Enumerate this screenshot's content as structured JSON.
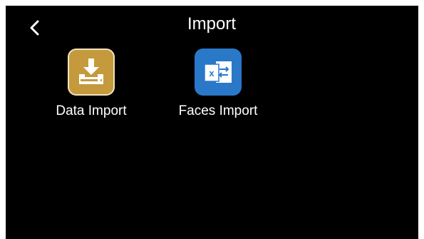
{
  "header": {
    "title": "Import"
  },
  "apps": [
    {
      "label": "Data Import",
      "icon": "download-tray-icon",
      "color": "#c59a3c"
    },
    {
      "label": "Faces Import",
      "icon": "excel-import-icon",
      "color": "#2a78c8"
    }
  ],
  "colors": {
    "background": "#000000",
    "text": "#ffffff"
  }
}
